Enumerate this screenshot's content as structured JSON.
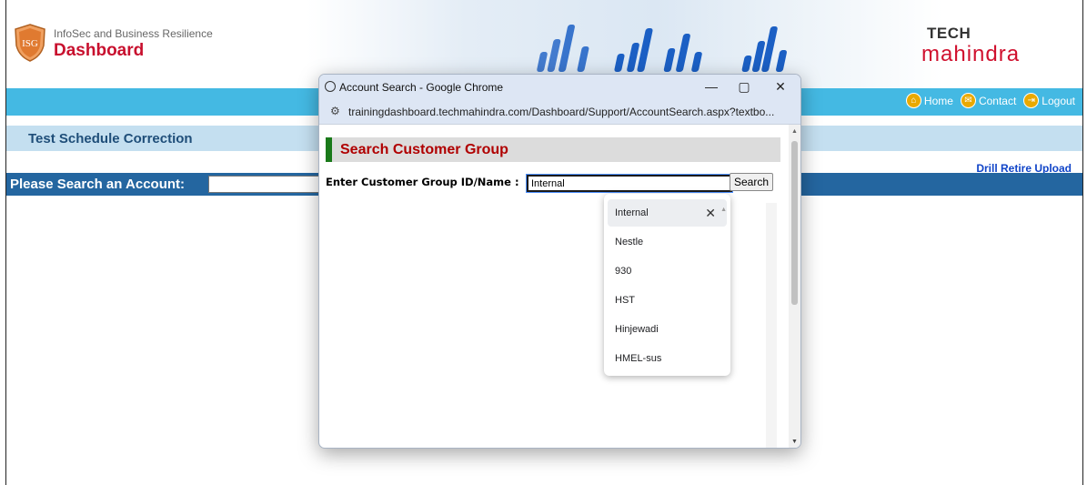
{
  "header": {
    "logo_badge": "ISG",
    "logo_subtitle": "InfoSec and Business Resilience",
    "logo_title": "Dashboard",
    "brand_line1": "TECH",
    "brand_line2": "mahindra"
  },
  "nav": {
    "home": "Home",
    "contact": "Contact",
    "logout": "Logout"
  },
  "page": {
    "section_title": "Test Schedule Correction",
    "drill_link": "Drill Retire Upload",
    "search_label": "Please Search an Account:",
    "search_value": ""
  },
  "popup": {
    "window_title": "Account Search - Google Chrome",
    "min": "—",
    "max": "▢",
    "close": "✕",
    "url": "trainingdashboard.techmahindra.com/Dashboard/Support/AccountSearch.aspx?textbo...",
    "heading": "Search Customer Group",
    "field_label": "Enter Customer Group ID/Name :",
    "field_value": "Internal",
    "search_button": "Search"
  },
  "autocomplete": {
    "items": [
      "Internal",
      "Nestle",
      "930",
      "HST",
      "Hinjewadi",
      "HMEL-sus"
    ],
    "remove_icon": "✕"
  },
  "colors": {
    "nav": "#44b9e3",
    "section": "#c4dff0",
    "search_row": "#2466a0",
    "heading_text": "#b00000",
    "heading_bar": "#1a7a1a",
    "brand_red": "#d0102e"
  }
}
